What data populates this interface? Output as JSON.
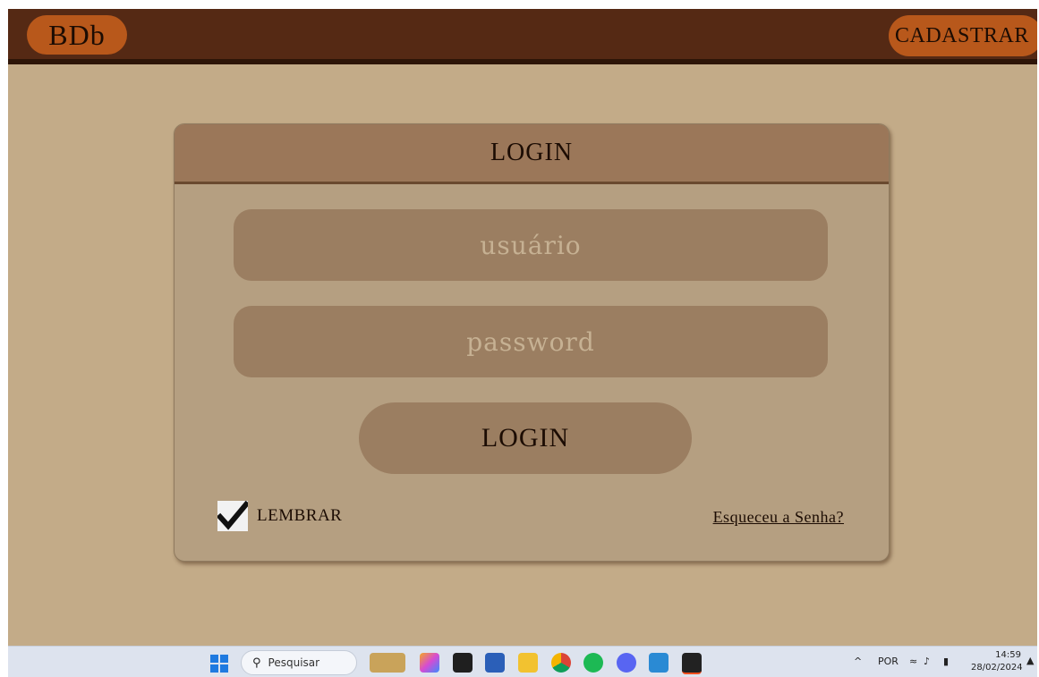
{
  "header": {
    "logo": "BDb",
    "register_label": "CADASTRAR"
  },
  "login_card": {
    "title": "LOGIN",
    "username_placeholder": "usuário",
    "password_placeholder": "password",
    "submit_label": "LOGIN",
    "remember_label": "LEMBRAR",
    "remember_checked": true,
    "forgot_label": "Esqueceu a Senha?"
  },
  "colors": {
    "background": "#c3ab88",
    "topbar": "#552914",
    "accent": "#b8581b",
    "card": "#b59f81",
    "card_header": "#9b7759",
    "field": "#9b7e61"
  },
  "taskbar": {
    "search_placeholder": "Pesquisar",
    "apps": [
      "widgets-icon",
      "copilot-icon",
      "terminal-icon",
      "store-icon",
      "file-explorer-icon",
      "chrome-icon",
      "spotify-icon",
      "discord-icon",
      "vscode-icon",
      "figma-icon"
    ],
    "tray_chevron": "^",
    "language": "POR",
    "time": "14:59",
    "date": "28/02/2024"
  }
}
